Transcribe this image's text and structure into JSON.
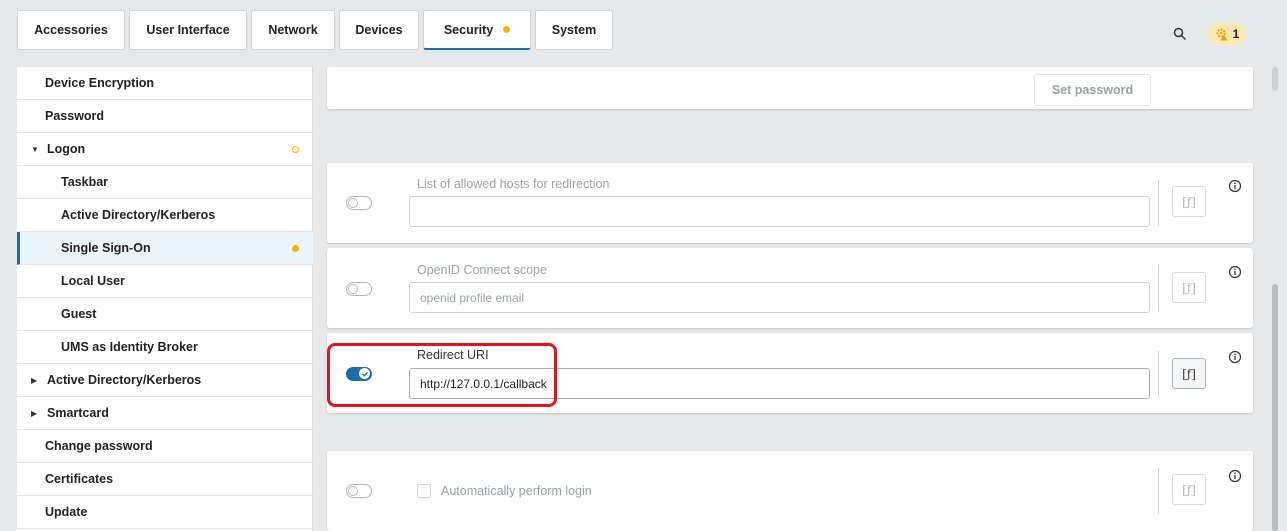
{
  "tabs": [
    {
      "label": "Accessories"
    },
    {
      "label": "User Interface"
    },
    {
      "label": "Network"
    },
    {
      "label": "Devices"
    },
    {
      "label": "Security",
      "active": true,
      "indicator": "dot"
    },
    {
      "label": "System"
    }
  ],
  "header": {
    "search_icon": "search-icon",
    "notification_icon": "gear-warning-icon",
    "notification_count": "1"
  },
  "sidebar": {
    "items": [
      {
        "label": "Device Encryption"
      },
      {
        "label": "Password"
      },
      {
        "label": "Logon",
        "expanded": true,
        "indicator": "ring"
      },
      {
        "label": "Taskbar"
      },
      {
        "label": "Active Directory/Kerberos"
      },
      {
        "label": "Single Sign-On",
        "selected": true,
        "indicator": "dot"
      },
      {
        "label": "Local User"
      },
      {
        "label": "Guest"
      },
      {
        "label": "UMS as Identity Broker"
      },
      {
        "label": "Active Directory/Kerberos",
        "collapsed": true
      },
      {
        "label": "Smartcard",
        "collapsed": true
      },
      {
        "label": "Change password"
      },
      {
        "label": "Certificates"
      },
      {
        "label": "Update"
      }
    ]
  },
  "main": {
    "set_password_label": "Set password",
    "fields": [
      {
        "label": "List of allowed hosts for redirection",
        "value": "",
        "enabled": false,
        "fx": "[ƒ]"
      },
      {
        "label": "OpenID Connect scope",
        "placeholder": "openid profile email",
        "enabled": false,
        "fx": "[ƒ]"
      },
      {
        "label": "Redirect URI",
        "value": "http://127.0.0.1/callback",
        "enabled": true,
        "fx": "[ƒ]"
      },
      {
        "label": "Automatically perform login",
        "type": "checkbox",
        "checked": false,
        "enabled": false,
        "fx": "[ƒ]"
      }
    ]
  },
  "colors": {
    "accent": "#1a6fa8",
    "indicator": "#f2b600",
    "highlight": "#e0151b"
  }
}
